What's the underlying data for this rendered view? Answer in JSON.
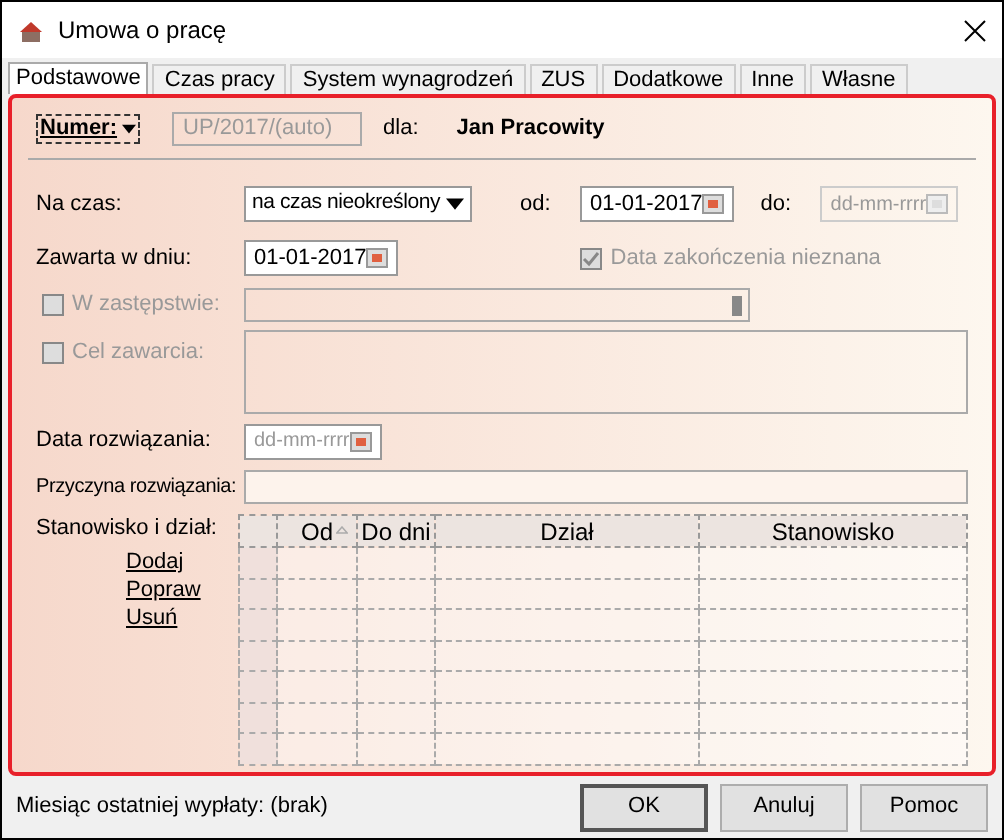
{
  "window": {
    "title": "Umowa o pracę"
  },
  "tabs": [
    {
      "label": "Podstawowe",
      "selected": true
    },
    {
      "label": "Czas pracy",
      "selected": false
    },
    {
      "label": "System wynagrodzeń",
      "selected": false
    },
    {
      "label": "ZUS",
      "selected": false
    },
    {
      "label": "Dodatkowe",
      "selected": false
    },
    {
      "label": "Inne",
      "selected": false
    },
    {
      "label": "Własne",
      "selected": false
    }
  ],
  "numer": {
    "label": "Numer:",
    "value": "UP/2017/(auto)",
    "disabled": true,
    "for_label": "dla:",
    "employee": "Jan Pracowity"
  },
  "na_czas": {
    "label": "Na czas:",
    "value": "na czas nieokreślony",
    "from_label": "od:",
    "from": {
      "value": "01-01-2017",
      "disabled": false
    },
    "to_label": "do:",
    "to": {
      "placeholder": "dd-mm-rrrr",
      "disabled": true
    }
  },
  "zawarta": {
    "label": "Zawarta w dniu:",
    "date": {
      "value": "01-01-2017",
      "disabled": false
    },
    "end_unknown": {
      "label": "Data zakończenia nieznana",
      "checked": true,
      "disabled": true
    }
  },
  "w_zastepstwie": {
    "label": "W zastępstwie:",
    "checked": false,
    "disabled": true
  },
  "cel_zawarcia": {
    "label": "Cel zawarcia:",
    "checked": false,
    "disabled": true
  },
  "data_rozwiazania": {
    "label": "Data rozwiązania:",
    "date": {
      "placeholder": "dd-mm-rrrr",
      "disabled": false
    }
  },
  "przyczyna": {
    "label": "Przyczyna rozwiązania:"
  },
  "stanowisko": {
    "label": "Stanowisko i dział:",
    "links": [
      "Dodaj",
      "Popraw",
      "Usuń"
    ],
    "columns": [
      {
        "label": "Od",
        "sorted": true
      },
      {
        "label": "Do dni",
        "sorted": false
      },
      {
        "label": "Dział",
        "sorted": false
      },
      {
        "label": "Stanowisko",
        "sorted": false
      }
    ]
  },
  "status": "Miesiąc ostatniej wypłaty: (brak)",
  "buttons": [
    {
      "label": "OK",
      "default": true
    },
    {
      "label": "Anuluj",
      "default": false
    },
    {
      "label": "Pomoc",
      "default": false
    }
  ]
}
